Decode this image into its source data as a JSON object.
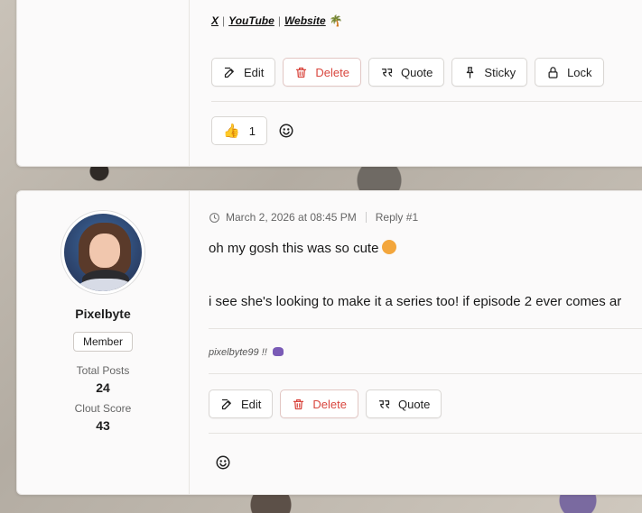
{
  "top_post": {
    "signature_links": [
      {
        "label": "X"
      },
      {
        "label": "YouTube"
      },
      {
        "label": "Website"
      }
    ],
    "link_separator": "|",
    "actions": {
      "edit": "Edit",
      "delete": "Delete",
      "quote": "Quote",
      "sticky": "Sticky",
      "lock": "Lock"
    },
    "reaction": {
      "emoji_name": "thumbs-up-icon",
      "count": "1"
    }
  },
  "reply_post": {
    "author": {
      "name": "Pixelbyte",
      "role": "Member",
      "total_posts_label": "Total Posts",
      "total_posts": "24",
      "clout_score_label": "Clout Score",
      "clout_score": "43"
    },
    "timestamp": "March 2, 2026 at 08:45 PM",
    "reply_number": "Reply #1",
    "paragraphs": [
      "oh my gosh this was so cute",
      "i see she's looking to make it a series too! if episode 2 ever comes ar"
    ],
    "signature": "pixelbyte99 !!",
    "actions": {
      "edit": "Edit",
      "delete": "Delete",
      "quote": "Quote"
    }
  },
  "colors": {
    "danger": "#d9463e",
    "card_bg": "#fbfafa"
  }
}
